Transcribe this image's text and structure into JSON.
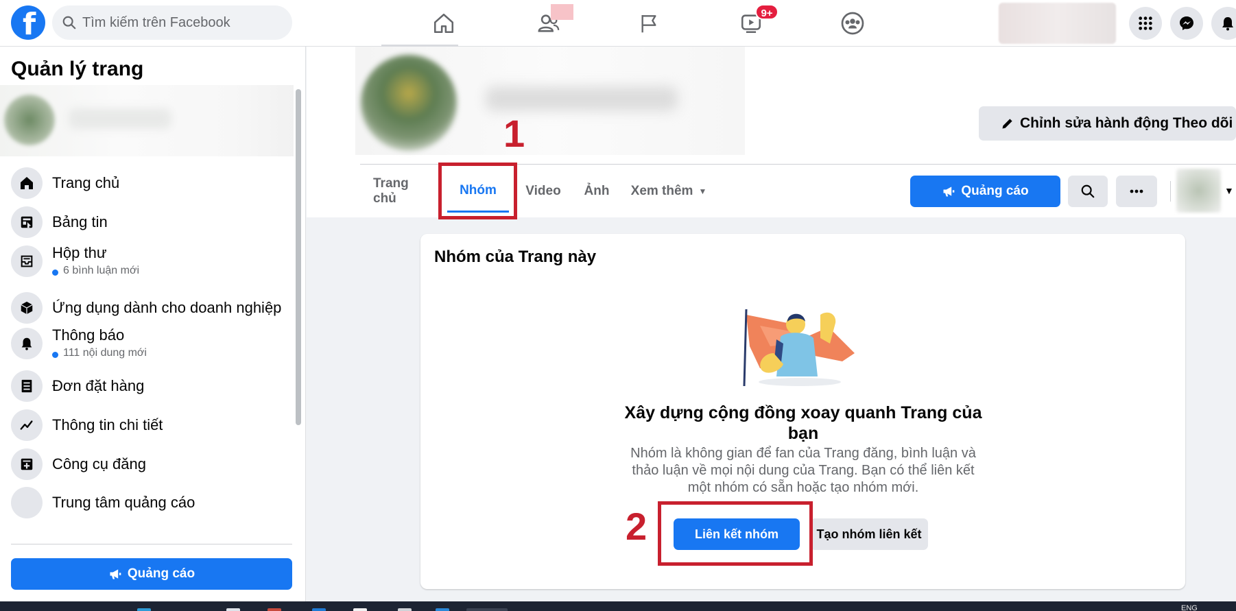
{
  "topbar": {
    "logo_letter": "f",
    "search_placeholder": "Tìm kiếm trên Facebook",
    "notification_badge": "9+"
  },
  "sidebar": {
    "title": "Quản lý trang",
    "items": [
      {
        "label": "Trang chủ",
        "icon": "home-icon"
      },
      {
        "label": "Bảng tin",
        "icon": "news-feed-icon"
      },
      {
        "label": "Hộp thư",
        "icon": "inbox-icon",
        "sub": "6 bình luận mới"
      },
      {
        "label": "Ứng dụng dành cho doanh nghiệp",
        "icon": "business-apps-icon"
      },
      {
        "label": "Thông báo",
        "icon": "bell-icon",
        "sub": "111 nội dung mới"
      },
      {
        "label": "Đơn đặt hàng",
        "icon": "orders-icon"
      },
      {
        "label": "Thông tin chi tiết",
        "icon": "insights-icon"
      },
      {
        "label": "Công cụ đăng",
        "icon": "publishing-tools-icon"
      },
      {
        "label": "Trung tâm quảng cáo",
        "icon": "ad-center-icon"
      }
    ],
    "ad_button": "Quảng cáo"
  },
  "page_header": {
    "edit_follow_button": "Chỉnh sửa hành động Theo dõi",
    "tabs": [
      "Trang chủ",
      "Nhóm",
      "Video",
      "Ảnh",
      "Xem thêm"
    ],
    "active_tab": "Nhóm",
    "ad_button": "Quảng cáo"
  },
  "groups_card": {
    "title": "Nhóm của Trang này",
    "headline": "Xây dựng cộng đồng xoay quanh Trang của bạn",
    "description": "Nhóm là không gian để fan của Trang đăng, bình luận và thảo luận về mọi nội dung của Trang. Bạn có thể liên kết một nhóm có sẵn hoặc tạo nhóm mới.",
    "link_group_button": "Liên kết nhóm",
    "create_group_button": "Tạo nhóm liên kết"
  },
  "annotations": {
    "step1": "1",
    "step2": "2"
  },
  "taskbar": {
    "lang": "ENG"
  },
  "colors": {
    "brand": "#1877f2",
    "annotation": "#c8202e",
    "badge": "#e41e3f"
  }
}
